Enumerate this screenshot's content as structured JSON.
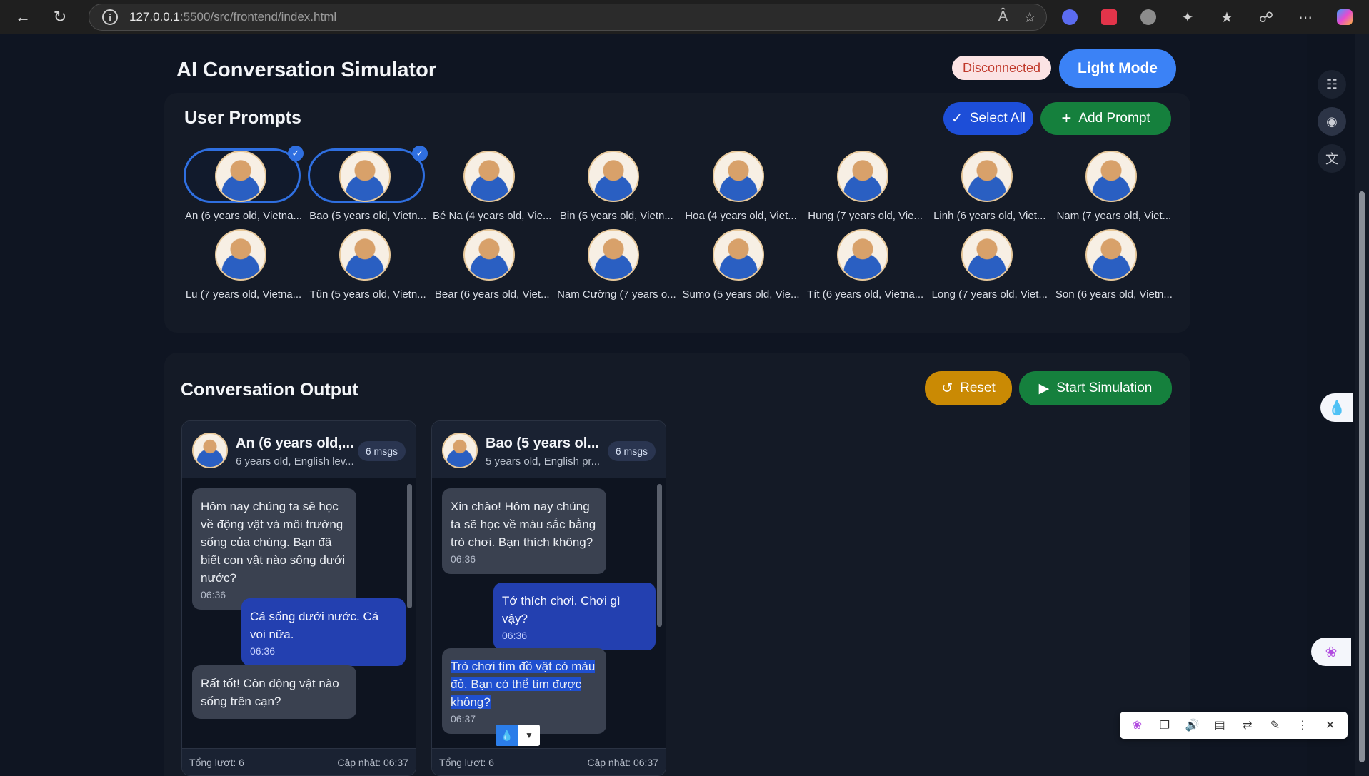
{
  "browser": {
    "url_host": "127.0.0.1",
    "url_path": ":5500/src/frontend/index.html"
  },
  "header": {
    "title": "AI Conversation Simulator",
    "status": "Disconnected",
    "mode_button": "Light Mode"
  },
  "prompts": {
    "title": "User Prompts",
    "select_all": "Select All",
    "add_prompt": "Add Prompt",
    "items": [
      {
        "name": "An (6 years old, Vietna...",
        "selected": true
      },
      {
        "name": "Bao (5 years old, Vietn...",
        "selected": true
      },
      {
        "name": "Bé Na (4 years old, Vie...",
        "selected": false
      },
      {
        "name": "Bin (5 years old, Vietn...",
        "selected": false
      },
      {
        "name": "Hoa (4 years old, Viet...",
        "selected": false
      },
      {
        "name": "Hung (7 years old, Vie...",
        "selected": false
      },
      {
        "name": "Linh (6 years old, Viet...",
        "selected": false
      },
      {
        "name": "Nam (7 years old, Viet...",
        "selected": false
      },
      {
        "name": "Lu (7 years old, Vietna...",
        "selected": false
      },
      {
        "name": "Tũn (5 years old, Vietn...",
        "selected": false
      },
      {
        "name": "Bear (6 years old, Viet...",
        "selected": false
      },
      {
        "name": "Nam Cường (7 years o...",
        "selected": false
      },
      {
        "name": "Sumo (5 years old, Vie...",
        "selected": false
      },
      {
        "name": "Tít (6 years old, Vietna...",
        "selected": false
      },
      {
        "name": "Long (7 years old, Viet...",
        "selected": false
      },
      {
        "name": "Son (6 years old, Vietn...",
        "selected": false
      }
    ]
  },
  "output": {
    "title": "Conversation Output",
    "reset": "Reset",
    "start": "Start Simulation",
    "conversations": [
      {
        "name": "An (6 years old,...",
        "sub": "6 years old, English lev...",
        "badge": "6 msgs",
        "messages": [
          {
            "role": "ai",
            "text": "Hôm nay chúng ta sẽ học về động vật và môi trường sống của chúng. Bạn đã biết con vật nào sống dưới nước?",
            "time": "06:36"
          },
          {
            "role": "user",
            "text": "Cá sống dưới nước. Cá voi nữa.",
            "time": "06:36"
          },
          {
            "role": "ai",
            "text": "Rất tốt! Còn động vật nào sống trên cạn?",
            "time": ""
          }
        ],
        "footer_left": "Tổng lượt: 6",
        "footer_right": "Cập nhật: 06:37"
      },
      {
        "name": "Bao (5 years ol...",
        "sub": "5 years old, English pr...",
        "badge": "6 msgs",
        "messages": [
          {
            "role": "ai",
            "text": "Xin chào! Hôm nay chúng ta sẽ học về màu sắc bằng trò chơi. Bạn thích không?",
            "time": "06:36"
          },
          {
            "role": "user",
            "text": "Tớ thích chơi. Chơi gì vậy?",
            "time": "06:36"
          },
          {
            "role": "ai",
            "text": "Trò chơi tìm đồ vật có màu đỏ. Bạn có thể tìm được không?",
            "time": "06:37"
          }
        ],
        "footer_left": "Tổng lượt: 6",
        "footer_right": "Cập nhật: 06:37"
      }
    ]
  },
  "colors": {
    "accent": "#3b82f6",
    "success": "#15803d",
    "warning": "#ca8a04",
    "danger": "#c0392b"
  }
}
